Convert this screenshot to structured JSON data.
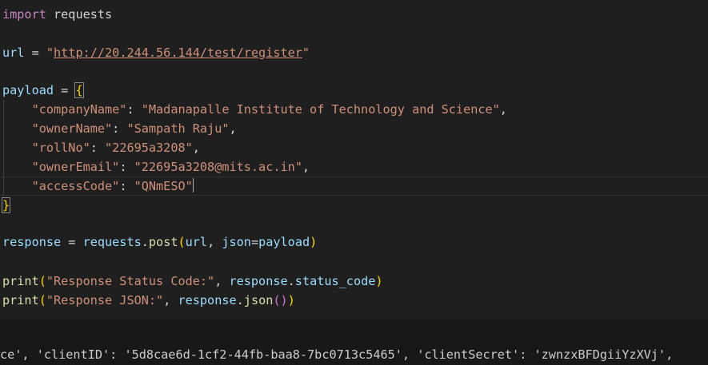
{
  "editor": {
    "code": {
      "l1": {
        "kw": "import",
        "mod": " requests"
      },
      "l3": {
        "name": "url",
        "eq": " = ",
        "q1": "\"",
        "url": "http://20.244.56.144/test/register",
        "q2": "\""
      },
      "l5": {
        "name": "payload",
        "eq": " = ",
        "brace": "{"
      },
      "l6": {
        "key": "\"companyName\"",
        "colon": ": ",
        "val": "\"Madanapalle Institute of Technology and Science\"",
        "comma": ","
      },
      "l7": {
        "key": "\"ownerName\"",
        "colon": ": ",
        "val": "\"Sampath Raju\"",
        "comma": ","
      },
      "l8": {
        "key": "\"rollNo\"",
        "colon": ": ",
        "val": "\"22695a3208\"",
        "comma": ","
      },
      "l9": {
        "key": "\"ownerEmail\"",
        "colon": ": ",
        "val": "\"22695a3208@mits.ac.in\"",
        "comma": ","
      },
      "l10": {
        "key": "\"accessCode\"",
        "colon": ": ",
        "val": "\"QNmESO\""
      },
      "l11": {
        "brace": "}"
      },
      "l13": {
        "name": "response",
        "eq": " = ",
        "obj": "requests",
        "dot": ".",
        "fn": "post",
        "p1": "(",
        "a1": "url",
        "sep": ", ",
        "a2": "json",
        "eq2": "=",
        "a3": "payload",
        "p2": ")"
      },
      "l15": {
        "fn": "print",
        "p1": "(",
        "str": "\"Response Status Code:\"",
        "sep": ", ",
        "obj": "response",
        "dot": ".",
        "attr": "status_code",
        "p2": ")"
      },
      "l16": {
        "fn": "print",
        "p1": "(",
        "str": "\"Response JSON:\"",
        "sep": ", ",
        "obj": "response",
        "dot": ".",
        "m": "json",
        "p3": "()",
        "p2": ")"
      }
    }
  },
  "terminal": {
    "output": "ce', 'clientID': '5d8cae6d-1cf2-44fb-baa8-7bc0713c5465', 'clientSecret': 'zwnzxBFDgiiYzXVj',"
  }
}
